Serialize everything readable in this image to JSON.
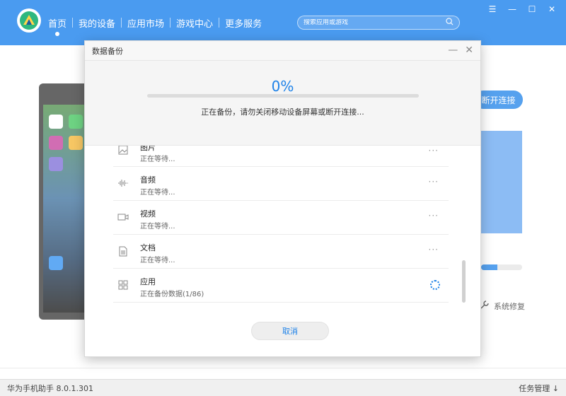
{
  "header": {
    "nav": [
      "首页",
      "我的设备",
      "应用市场",
      "游戏中心",
      "更多服务"
    ],
    "active_index": 0,
    "search_placeholder": "搜索应用或游戏",
    "win_controls": [
      "☰",
      "—",
      "☐",
      "✕"
    ]
  },
  "background": {
    "connect_button": "断开连接",
    "repair_label": "系统修复",
    "status_left": "华为手机助手  8.0.1.301",
    "status_right": "任务管理  ↓"
  },
  "dialog": {
    "title": "数据备份",
    "controls": [
      "—",
      "✕"
    ],
    "percent": "0%",
    "progress": 0,
    "message": "正在备份，请勿关闭移动设备屏幕或断开连接...",
    "items": [
      {
        "name": "图片",
        "status": "正在等待...",
        "icon": "image-icon",
        "state": "waiting"
      },
      {
        "name": "音频",
        "status": "正在等待...",
        "icon": "audio-icon",
        "state": "waiting"
      },
      {
        "name": "视频",
        "status": "正在等待...",
        "icon": "video-icon",
        "state": "waiting"
      },
      {
        "name": "文档",
        "status": "正在等待...",
        "icon": "document-icon",
        "state": "waiting"
      },
      {
        "name": "应用",
        "status": "正在备份数据(1/86)",
        "icon": "apps-icon",
        "state": "in-progress"
      }
    ],
    "more_symbol": "···",
    "cancel_label": "取消"
  },
  "colors": {
    "accent": "#1e82e8",
    "header": "#4a9bf0"
  }
}
